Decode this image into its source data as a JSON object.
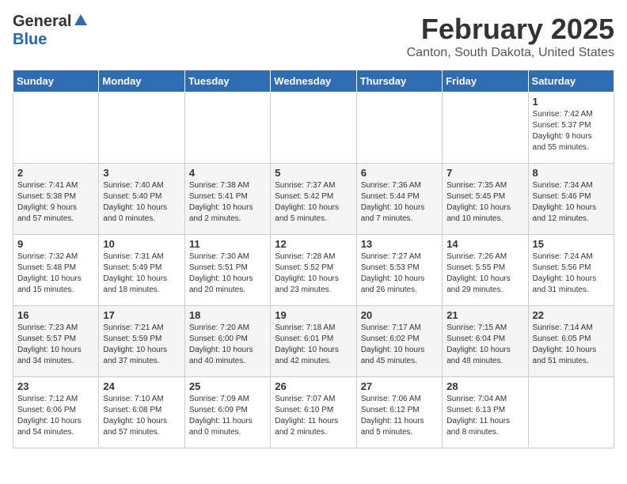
{
  "header": {
    "logo_general": "General",
    "logo_blue": "Blue",
    "month_title": "February 2025",
    "location": "Canton, South Dakota, United States"
  },
  "days_of_week": [
    "Sunday",
    "Monday",
    "Tuesday",
    "Wednesday",
    "Thursday",
    "Friday",
    "Saturday"
  ],
  "weeks": [
    [
      {
        "day": "",
        "info": ""
      },
      {
        "day": "",
        "info": ""
      },
      {
        "day": "",
        "info": ""
      },
      {
        "day": "",
        "info": ""
      },
      {
        "day": "",
        "info": ""
      },
      {
        "day": "",
        "info": ""
      },
      {
        "day": "1",
        "info": "Sunrise: 7:42 AM\nSunset: 5:37 PM\nDaylight: 9 hours\nand 55 minutes."
      }
    ],
    [
      {
        "day": "2",
        "info": "Sunrise: 7:41 AM\nSunset: 5:38 PM\nDaylight: 9 hours\nand 57 minutes."
      },
      {
        "day": "3",
        "info": "Sunrise: 7:40 AM\nSunset: 5:40 PM\nDaylight: 10 hours\nand 0 minutes."
      },
      {
        "day": "4",
        "info": "Sunrise: 7:38 AM\nSunset: 5:41 PM\nDaylight: 10 hours\nand 2 minutes."
      },
      {
        "day": "5",
        "info": "Sunrise: 7:37 AM\nSunset: 5:42 PM\nDaylight: 10 hours\nand 5 minutes."
      },
      {
        "day": "6",
        "info": "Sunrise: 7:36 AM\nSunset: 5:44 PM\nDaylight: 10 hours\nand 7 minutes."
      },
      {
        "day": "7",
        "info": "Sunrise: 7:35 AM\nSunset: 5:45 PM\nDaylight: 10 hours\nand 10 minutes."
      },
      {
        "day": "8",
        "info": "Sunrise: 7:34 AM\nSunset: 5:46 PM\nDaylight: 10 hours\nand 12 minutes."
      }
    ],
    [
      {
        "day": "9",
        "info": "Sunrise: 7:32 AM\nSunset: 5:48 PM\nDaylight: 10 hours\nand 15 minutes."
      },
      {
        "day": "10",
        "info": "Sunrise: 7:31 AM\nSunset: 5:49 PM\nDaylight: 10 hours\nand 18 minutes."
      },
      {
        "day": "11",
        "info": "Sunrise: 7:30 AM\nSunset: 5:51 PM\nDaylight: 10 hours\nand 20 minutes."
      },
      {
        "day": "12",
        "info": "Sunrise: 7:28 AM\nSunset: 5:52 PM\nDaylight: 10 hours\nand 23 minutes."
      },
      {
        "day": "13",
        "info": "Sunrise: 7:27 AM\nSunset: 5:53 PM\nDaylight: 10 hours\nand 26 minutes."
      },
      {
        "day": "14",
        "info": "Sunrise: 7:26 AM\nSunset: 5:55 PM\nDaylight: 10 hours\nand 29 minutes."
      },
      {
        "day": "15",
        "info": "Sunrise: 7:24 AM\nSunset: 5:56 PM\nDaylight: 10 hours\nand 31 minutes."
      }
    ],
    [
      {
        "day": "16",
        "info": "Sunrise: 7:23 AM\nSunset: 5:57 PM\nDaylight: 10 hours\nand 34 minutes."
      },
      {
        "day": "17",
        "info": "Sunrise: 7:21 AM\nSunset: 5:59 PM\nDaylight: 10 hours\nand 37 minutes."
      },
      {
        "day": "18",
        "info": "Sunrise: 7:20 AM\nSunset: 6:00 PM\nDaylight: 10 hours\nand 40 minutes."
      },
      {
        "day": "19",
        "info": "Sunrise: 7:18 AM\nSunset: 6:01 PM\nDaylight: 10 hours\nand 42 minutes."
      },
      {
        "day": "20",
        "info": "Sunrise: 7:17 AM\nSunset: 6:02 PM\nDaylight: 10 hours\nand 45 minutes."
      },
      {
        "day": "21",
        "info": "Sunrise: 7:15 AM\nSunset: 6:04 PM\nDaylight: 10 hours\nand 48 minutes."
      },
      {
        "day": "22",
        "info": "Sunrise: 7:14 AM\nSunset: 6:05 PM\nDaylight: 10 hours\nand 51 minutes."
      }
    ],
    [
      {
        "day": "23",
        "info": "Sunrise: 7:12 AM\nSunset: 6:06 PM\nDaylight: 10 hours\nand 54 minutes."
      },
      {
        "day": "24",
        "info": "Sunrise: 7:10 AM\nSunset: 6:08 PM\nDaylight: 10 hours\nand 57 minutes."
      },
      {
        "day": "25",
        "info": "Sunrise: 7:09 AM\nSunset: 6:09 PM\nDaylight: 11 hours\nand 0 minutes."
      },
      {
        "day": "26",
        "info": "Sunrise: 7:07 AM\nSunset: 6:10 PM\nDaylight: 11 hours\nand 2 minutes."
      },
      {
        "day": "27",
        "info": "Sunrise: 7:06 AM\nSunset: 6:12 PM\nDaylight: 11 hours\nand 5 minutes."
      },
      {
        "day": "28",
        "info": "Sunrise: 7:04 AM\nSunset: 6:13 PM\nDaylight: 11 hours\nand 8 minutes."
      },
      {
        "day": "",
        "info": ""
      }
    ]
  ]
}
